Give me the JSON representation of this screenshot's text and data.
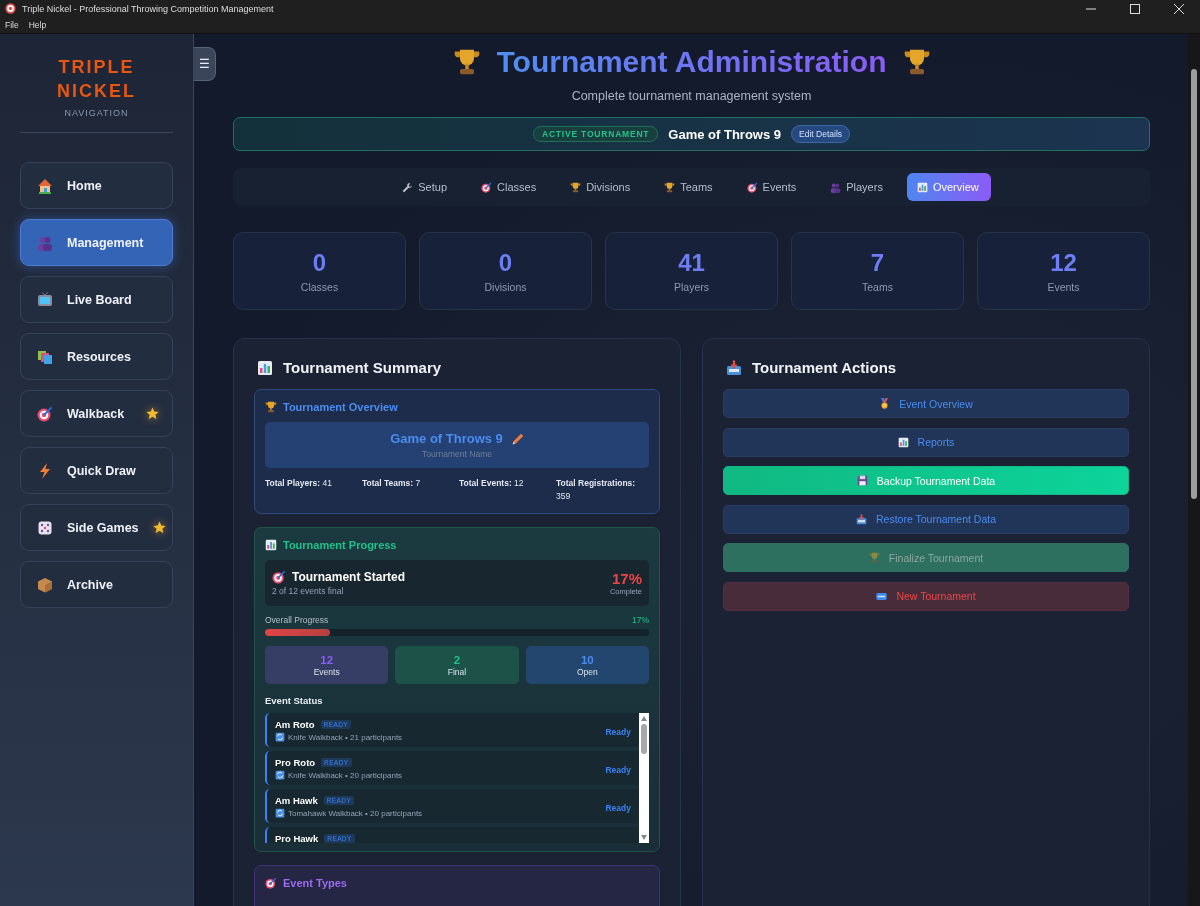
{
  "window": {
    "title": "Triple Nickel - Professional Throwing Competition Management"
  },
  "menu": [
    "File",
    "Help"
  ],
  "sidebar": {
    "brand": [
      "TRIPLE",
      "NICKEL"
    ],
    "subtitle": "NAVIGATION",
    "toggle": "☰",
    "items": [
      {
        "label": "Home",
        "selected": false,
        "featured": false
      },
      {
        "label": "Management",
        "selected": true,
        "featured": false
      },
      {
        "label": "Live Board",
        "selected": false,
        "featured": false
      },
      {
        "label": "Resources",
        "selected": false,
        "featured": false
      },
      {
        "label": "Walkback",
        "selected": false,
        "featured": true
      },
      {
        "label": "Quick Draw",
        "selected": false,
        "featured": false
      },
      {
        "label": "Side Games",
        "selected": false,
        "featured": true
      },
      {
        "label": "Archive",
        "selected": false,
        "featured": false
      }
    ]
  },
  "header": {
    "title": "Tournament Administration",
    "subtitle": "Complete tournament management system"
  },
  "active_tournament": {
    "badge": "ACTIVE TOURNAMENT",
    "name": "Game of Throws 9",
    "button": "Edit Details"
  },
  "tabs": [
    {
      "label": "Setup",
      "selected": false
    },
    {
      "label": "Classes",
      "selected": false
    },
    {
      "label": "Divisions",
      "selected": false
    },
    {
      "label": "Teams",
      "selected": false
    },
    {
      "label": "Events",
      "selected": false
    },
    {
      "label": "Players",
      "selected": false
    },
    {
      "label": "Overview",
      "selected": true
    }
  ],
  "stats": [
    {
      "value": "0",
      "label": "Classes"
    },
    {
      "value": "0",
      "label": "Divisions"
    },
    {
      "value": "41",
      "label": "Players"
    },
    {
      "value": "7",
      "label": "Teams"
    },
    {
      "value": "12",
      "label": "Events"
    }
  ],
  "summary": {
    "title": "Tournament Summary",
    "overview": {
      "title": "Tournament Overview",
      "name": "Game of Throws 9",
      "name_caption": "Tournament Name",
      "totals": [
        {
          "label": "Total Players:",
          "value": "41"
        },
        {
          "label": "Total Teams:",
          "value": "7"
        },
        {
          "label": "Total Events:",
          "value": "12"
        },
        {
          "label": "Total Registrations:",
          "value": "359"
        }
      ]
    },
    "progress": {
      "title": "Tournament Progress",
      "status": "Tournament Started",
      "detail": "2 of 12 events final",
      "percent": "17%",
      "percent_caption": "Complete",
      "bar_label": "Overall Progress",
      "bar_reading": "17%",
      "level": 0.17,
      "counts": [
        {
          "kind": "total",
          "value": "12",
          "label": "Events"
        },
        {
          "kind": "final",
          "value": "2",
          "label": "Final"
        },
        {
          "kind": "open",
          "value": "10",
          "label": "Open"
        }
      ],
      "event_status_title": "Event Status",
      "events": [
        {
          "name": "Am Roto",
          "badge": "READY",
          "detail": "Knife Walkback • 21 participants",
          "status": "Ready"
        },
        {
          "name": "Pro Roto",
          "badge": "READY",
          "detail": "Knife Walkback • 20 participants",
          "status": "Ready"
        },
        {
          "name": "Am Hawk",
          "badge": "READY",
          "detail": "Tomahawk Walkback • 20 participants",
          "status": "Ready"
        },
        {
          "name": "Pro Hawk",
          "badge": "READY"
        }
      ]
    },
    "event_types": {
      "title": "Event Types"
    }
  },
  "actions": {
    "title": "Tournament Actions",
    "buttons": [
      {
        "label": "Event Overview",
        "kind": "default"
      },
      {
        "label": "Reports",
        "kind": "default"
      },
      {
        "label": "Backup Tournament Data",
        "kind": "success"
      },
      {
        "label": "Restore Tournament Data",
        "kind": "default"
      },
      {
        "label": "Finalize Tournament",
        "kind": "disabled"
      },
      {
        "label": "New Tournament",
        "kind": "danger"
      }
    ]
  }
}
